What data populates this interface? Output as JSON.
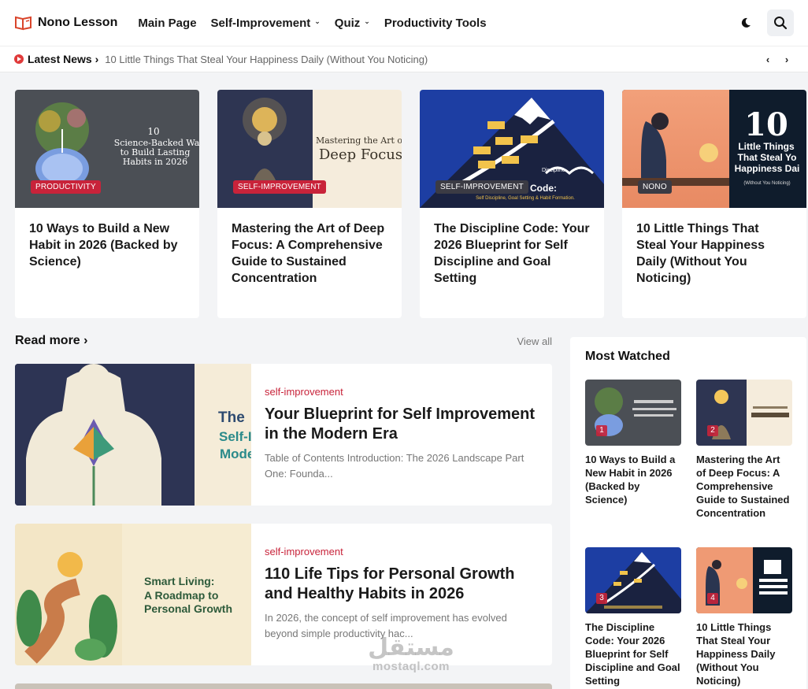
{
  "header": {
    "logo_text": "Nono Lesson",
    "nav": [
      {
        "label": "Main Page",
        "dropdown": false
      },
      {
        "label": "Self-Improvement",
        "dropdown": true
      },
      {
        "label": "Quiz",
        "dropdown": true
      },
      {
        "label": "Productivity Tools",
        "dropdown": false
      }
    ],
    "icons": [
      "dark-mode-icon",
      "search-icon"
    ]
  },
  "ticker": {
    "label": "Latest News",
    "text": "10 Little Things That Steal Your Happiness Daily (Without You Noticing)"
  },
  "featured": [
    {
      "badge": "PRODUCTIVITY",
      "title": "10 Ways to Build a New Habit in 2026 (Backed by Science)",
      "image_text": [
        "10",
        "Science-Backed Wa",
        "to Build Lasting",
        "Habits in 2026"
      ]
    },
    {
      "badge": "SELF-IMPROVEMENT",
      "title": "Mastering the Art of Deep Focus: A Comprehensive Guide to Sustained Concentration",
      "image_text": [
        "Mastering the Art of",
        "Deep Focus"
      ]
    },
    {
      "badge": "SELF-IMPROVEMENT",
      "title": "The Discipline Code: Your 2026 Blueprint for Self Discipline and Goal Setting",
      "image_text": [
        "Code:",
        "Self Discipline, Goal Setting & Habit Formation.",
        "Discipline"
      ]
    },
    {
      "badge": "NONO",
      "title": "10 Little Things That Steal Your Happiness Daily (Without You Noticing)",
      "image_text": [
        "10",
        "Little Things",
        "That Steal Yo",
        "Happiness Dai",
        "(Without You Noticing)"
      ]
    }
  ],
  "read_more": {
    "title": "Read more",
    "view_all": "View all",
    "posts": [
      {
        "category": "self-improvement",
        "title": "Your Blueprint for Self Improvement in the Modern Era",
        "excerpt": "Table of Contents Introduction: The 2026 Landscape Part One: Founda...",
        "image_text": [
          "The",
          "Self-I",
          "Mode"
        ]
      },
      {
        "category": "self-improvement",
        "title": "110 Life Tips for Personal Growth and Healthy Habits in 2026",
        "excerpt": "In 2026, the concept of self improvement has evolved beyond simple productivity hac...",
        "image_text": [
          "Smart Living:",
          "A Roadmap to",
          "Personal Growth"
        ]
      }
    ]
  },
  "sidebar": {
    "title": "Most Watched",
    "items": [
      {
        "rank": "1",
        "title": "10 Ways to Build a New Habit in 2026 (Backed by Science)"
      },
      {
        "rank": "2",
        "title": "Mastering the Art of Deep Focus: A Comprehensive Guide to Sustained Concentration"
      },
      {
        "rank": "3",
        "title": "The Discipline Code: Your 2026 Blueprint for Self Discipline and Goal Setting"
      },
      {
        "rank": "4",
        "title": "10 Little Things That Steal Your Happiness Daily (Without You Noticing)"
      }
    ]
  },
  "watermark": {
    "arabic": "مستقل",
    "latin": "mostaql.com"
  },
  "colors": {
    "accent": "#c8233a",
    "background": "#f3f4f6",
    "card": "#ffffff"
  }
}
